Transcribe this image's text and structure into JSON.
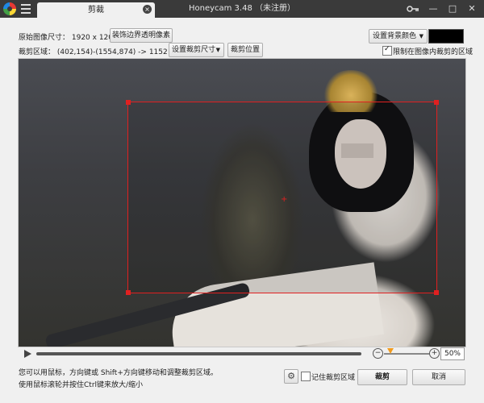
{
  "titlebar": {
    "tab_label": "剪裁",
    "tab_close": "×",
    "window_title": "Honeycam 3.48 （未注册）",
    "minimize": "—",
    "maximize": "□",
    "close": "✕"
  },
  "info": {
    "original_size": "原始图像尺寸：  1920 x 1200",
    "crop_region": "裁剪区域：  (402,154)-(1554,874) -> 1152 x 720"
  },
  "buttons": {
    "trim_transparent": "装饰边界透明像素",
    "set_crop_size": "设置裁剪尺寸",
    "crop_position": "裁剪位置",
    "set_bg_color": "设置背景颜色",
    "crop": "裁剪",
    "cancel": "取消"
  },
  "options": {
    "limit_to_image": "限制在图像内裁剪的区域",
    "remember_region": "记住裁剪区域"
  },
  "hints": {
    "line1": "您可以用鼠标，方向键或 Shift+方向键移动和调整裁剪区域。",
    "line2": "使用鼠标滚轮并按住Ctrl键来放大/缩小"
  },
  "playback": {
    "zoom": "50%",
    "zoom_fraction": 0.15
  },
  "colors": {
    "background_swatch": "#000000",
    "crop_outline": "#e02020",
    "zoom_thumb": "#f29b1d"
  }
}
